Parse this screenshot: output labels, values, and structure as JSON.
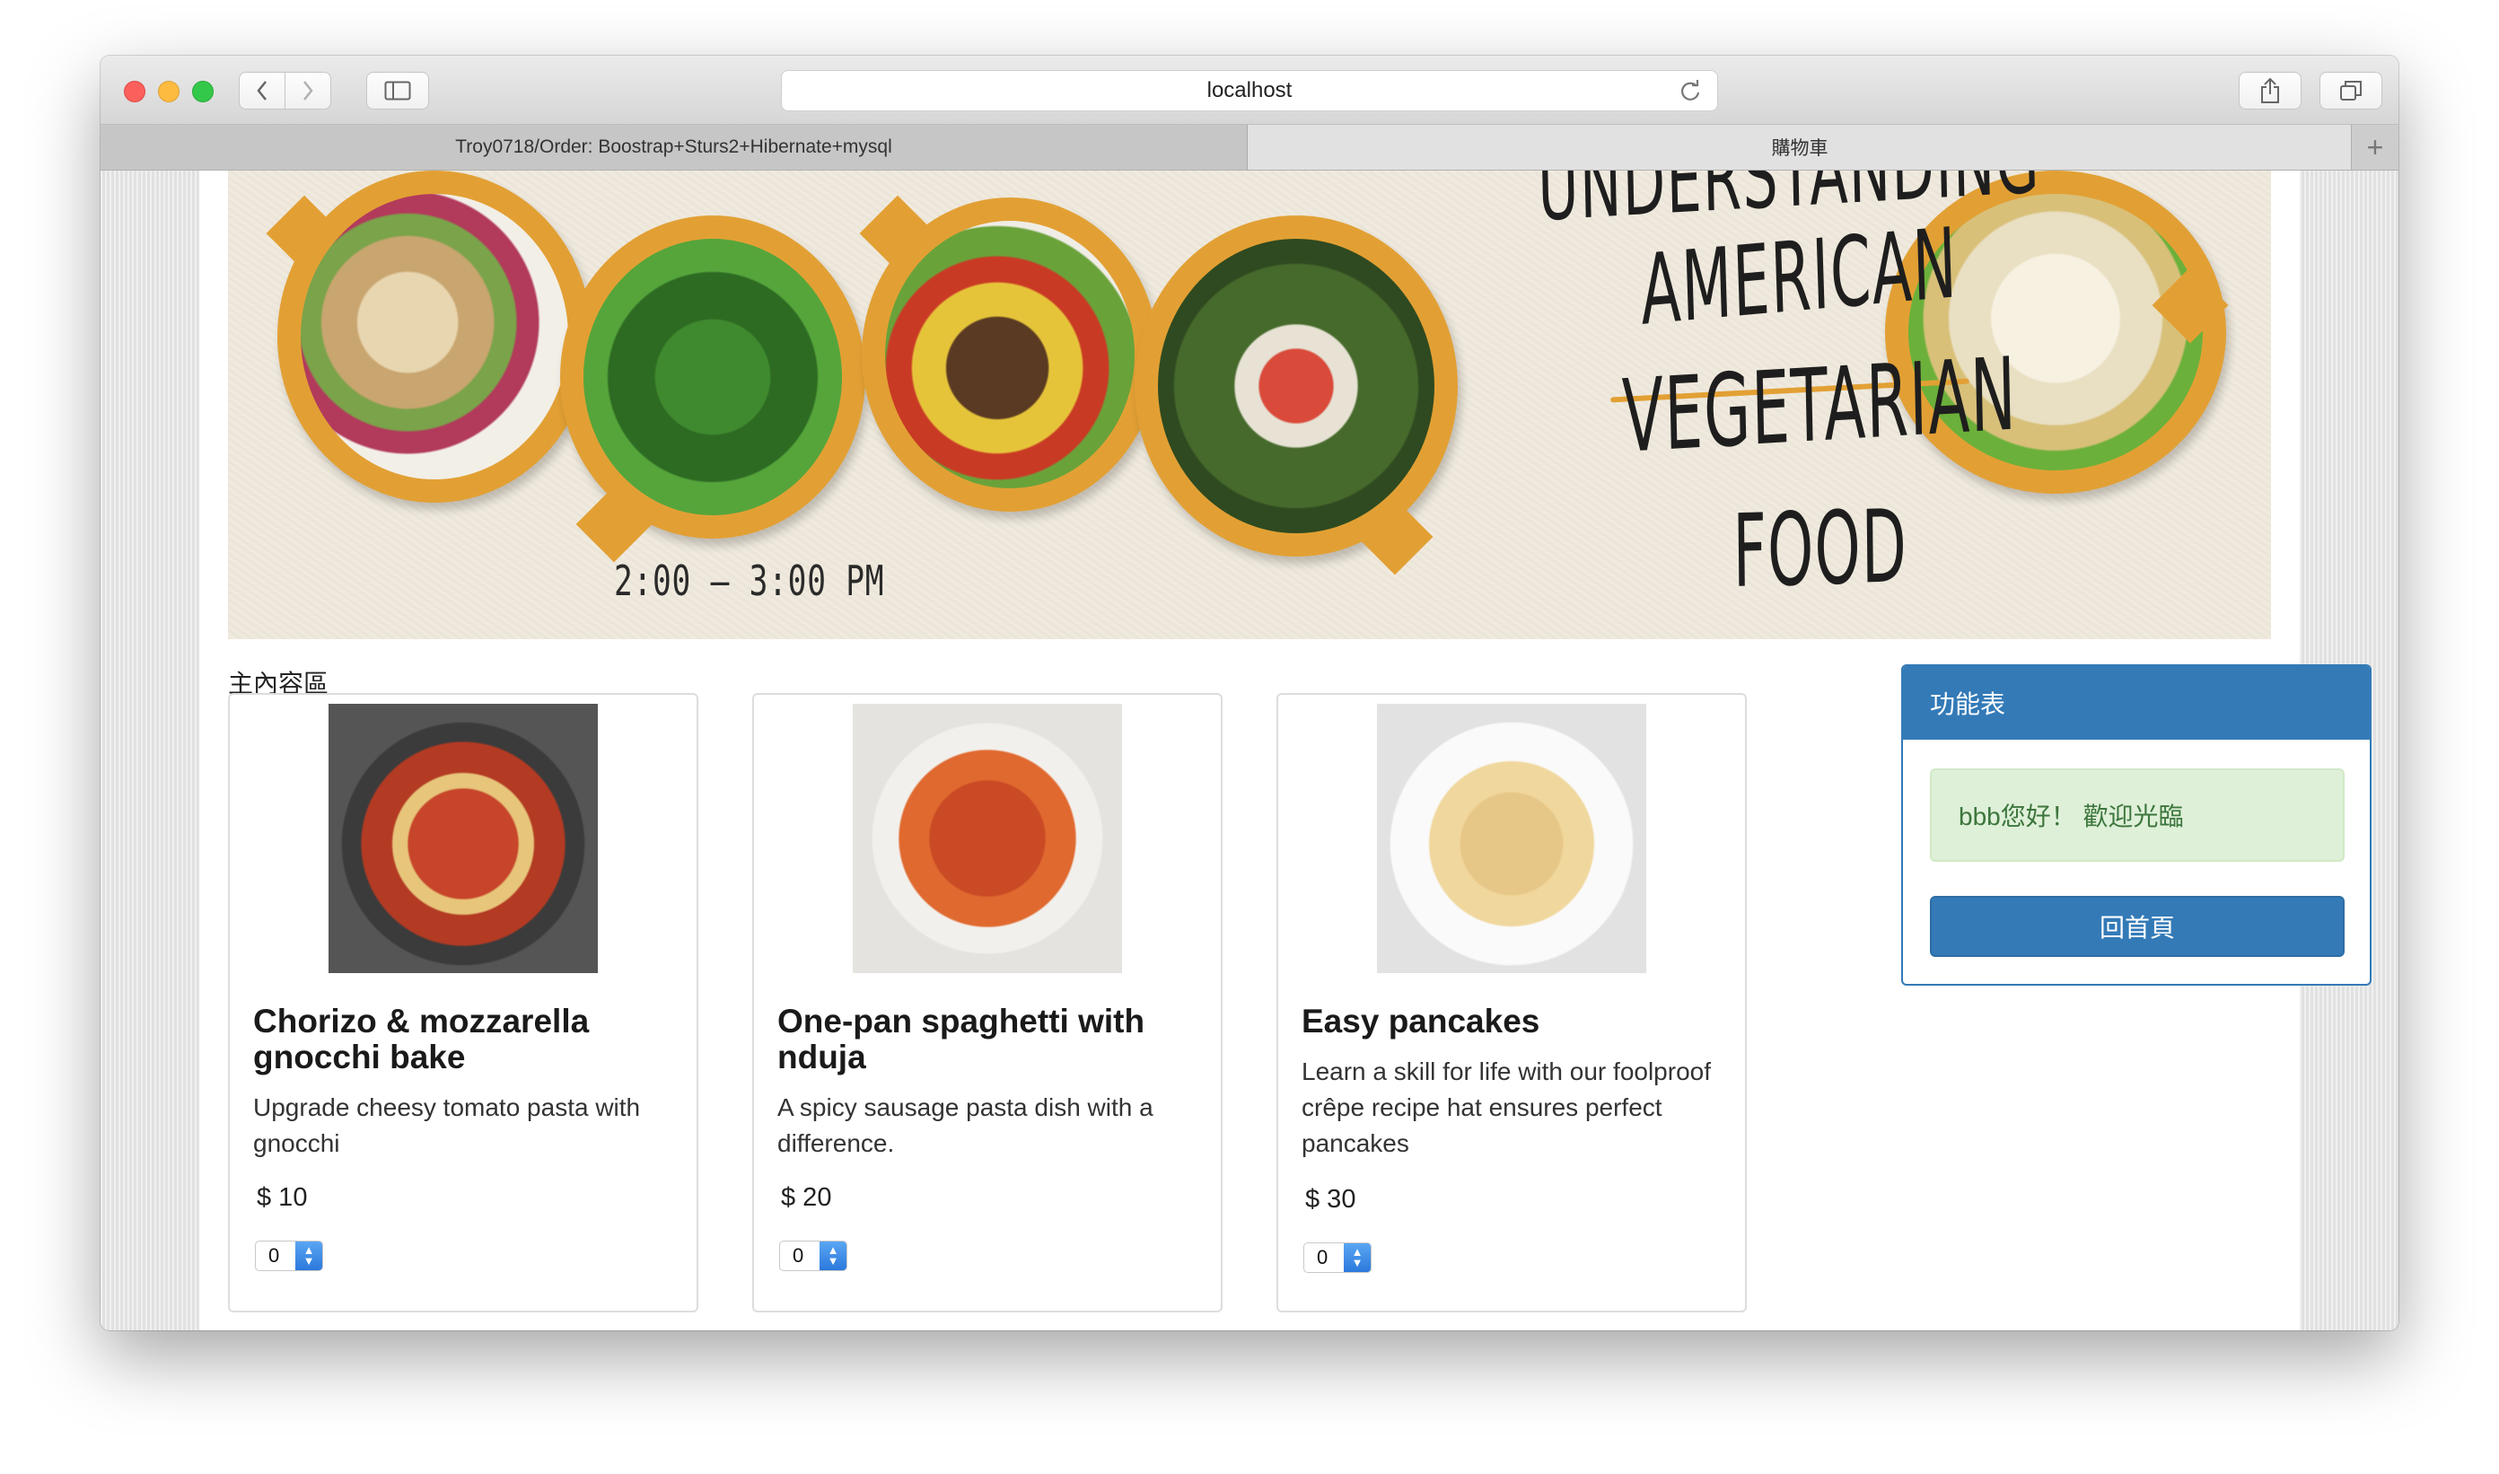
{
  "browser": {
    "url": "localhost",
    "tabs": [
      {
        "label": "Troy0718/Order: Boostrap+Sturs2+Hibernate+mysql"
      },
      {
        "label": "購物車"
      }
    ],
    "new_tab_symbol": "+"
  },
  "banner": {
    "time": "2:00 – 3:00 PM",
    "title_lines": [
      "UNDERSTANDING",
      "AMERICAN",
      "VEGETARIAN",
      "FOOD"
    ],
    "accent_color": "#e2a034"
  },
  "main": {
    "section_label": "主內容區",
    "products": [
      {
        "title": "Chorizo & mozzarella gnocchi bake",
        "description": "Upgrade cheesy tomato pasta with gnocchi",
        "price": "$ 10",
        "quantity": "0"
      },
      {
        "title": "One-pan spaghetti with nduja",
        "description": "A spicy sausage pasta dish with a difference.",
        "price": "$ 20",
        "quantity": "0"
      },
      {
        "title": "Easy pancakes",
        "description": "Learn a skill for life with our foolproof crêpe recipe hat ensures perfect pancakes",
        "price": "$ 30",
        "quantity": "0"
      }
    ]
  },
  "sidebar": {
    "heading": "功能表",
    "welcome": "bbb您好！ 歡迎光臨",
    "home_button": "回首頁",
    "primary_color": "#337ab7"
  }
}
